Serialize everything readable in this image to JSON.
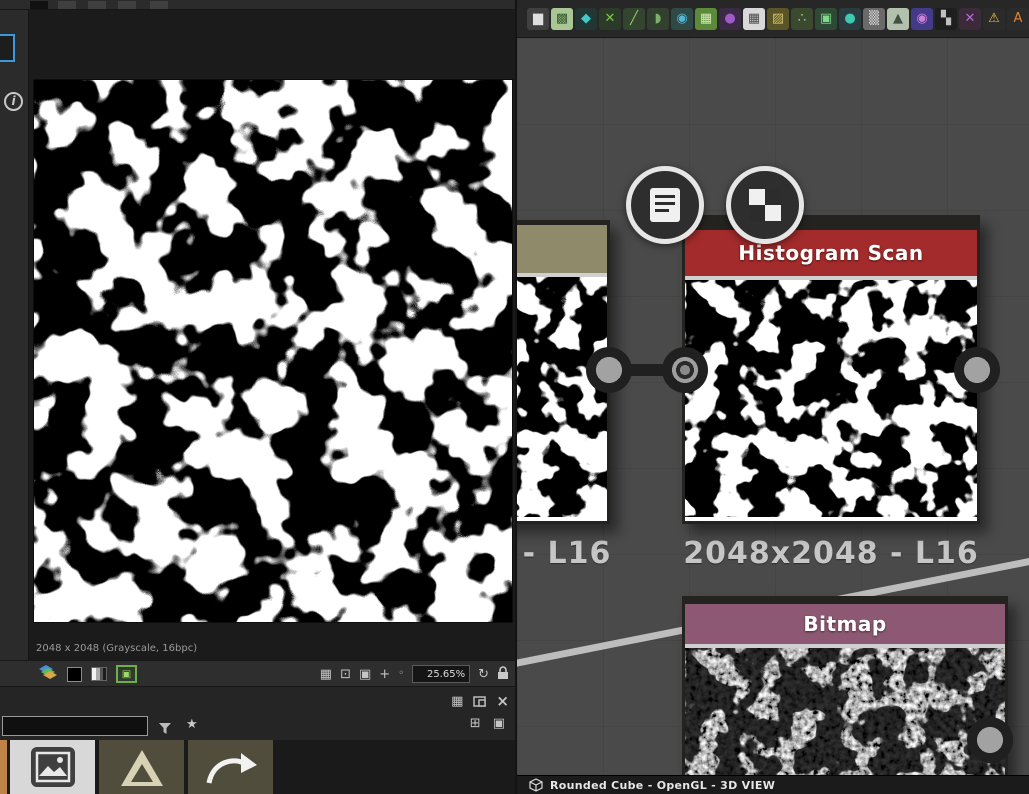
{
  "colors": {
    "graph_background": "#4a4a4a",
    "panel_background": "#2b2b2b",
    "accent_blue": "#3a9ad9",
    "histogram_header": "#a32b2b",
    "bitmap_header": "#8d5873",
    "partial_node_header": "#8f8a6a",
    "node_label_text": "#c6c6c6"
  },
  "view2d": {
    "status_text": "2048 x 2048 (Grayscale, 16bpc)",
    "zoom_value": "25.65%"
  },
  "library": {
    "filter_value": ""
  },
  "graph": {
    "partial_node": {
      "label": "- L16",
      "header_style": "background:#8f8a6a"
    },
    "histogram_node": {
      "title": "Histogram Scan",
      "label": "2048x2048 - L16",
      "header_style": "background:#a32b2b"
    },
    "bitmap_node": {
      "title": "Bitmap",
      "header_style": "background:#8d5873"
    }
  },
  "viewport_bar": {
    "text": "Rounded Cube - OpenGL - 3D VIEW"
  },
  "icon_glyphs": {
    "info": "i",
    "tiling": "▦",
    "fit": "⊡",
    "frame": "▣",
    "pan": "+",
    "dot": "◦",
    "refresh": "↻",
    "grid": "▦",
    "close": "×",
    "star": "★",
    "grid_plus": "⊞",
    "panel": "▣",
    "image_view": "▣"
  },
  "node_toolbar": {
    "icons": [
      {
        "name": "histogram-icon",
        "glyph": "▆",
        "style": "background:#404040;color:#e0e0e0"
      },
      {
        "name": "uniform-color-icon",
        "glyph": "▩",
        "style": "background:#a8c794;color:#355a2f"
      },
      {
        "name": "liquid-drop-icon",
        "glyph": "◆",
        "style": "background:#223733;color:#3fc9c9"
      },
      {
        "name": "cross-blend-icon",
        "glyph": "✕",
        "style": "background:#2c3a2a;color:#7ac943"
      },
      {
        "name": "slope-blur-icon",
        "glyph": "╱",
        "style": "background:#33452f;color:#9ccb69"
      },
      {
        "name": "droplet-icon",
        "glyph": "◗",
        "style": "background:#31402f;color:#7fb069"
      },
      {
        "name": "globe-icon",
        "glyph": "◉",
        "style": "background:#2f4a44;color:#52b7d9"
      },
      {
        "name": "green-grid-icon",
        "glyph": "▦",
        "style": "background:#5a8a3a;color:#d8e8b8"
      },
      {
        "name": "purple-orb-icon",
        "glyph": "●",
        "style": "background:#3a2a44;color:#a05ac9"
      },
      {
        "name": "transform-grid-icon",
        "glyph": "▦",
        "style": "background:#d8d8d8;color:#4a4a4a"
      },
      {
        "name": "olive-pattern-icon",
        "glyph": "▨",
        "style": "background:#5a5526;color:#cfc169"
      },
      {
        "name": "scatter-icon",
        "glyph": "∴",
        "style": "background:#3a4a2f;color:#9fd96a"
      },
      {
        "name": "tile-icon",
        "glyph": "▣",
        "style": "background:#2f4a34;color:#7fd98a"
      },
      {
        "name": "teal-sphere-icon",
        "glyph": "●",
        "style": "background:#2a3c40;color:#3fc9b0"
      },
      {
        "name": "noise-icon",
        "glyph": "▒",
        "style": "background:#6a6a6a;color:#d8d8d8"
      },
      {
        "name": "triangle-icon",
        "glyph": "▲",
        "style": "background:#b2c0ae;color:#41503f"
      },
      {
        "name": "color-sphere-icon",
        "glyph": "◉",
        "style": "background:#433a8a;color:#d07fd9"
      },
      {
        "name": "checker-small-icon",
        "glyph": "▚",
        "style": "background:#1e1e1e;color:#c0c0c0"
      },
      {
        "name": "purple-cross-icon",
        "glyph": "✕",
        "style": "background:#3a2a3a;color:#b96ad9"
      },
      {
        "name": "warning-icon",
        "glyph": "⚠",
        "style": "background:#2b2b2b;color:#e8c33a"
      },
      {
        "name": "text-node-icon",
        "glyph": "A",
        "style": "background:#2b2b2b;color:#e8832a"
      }
    ]
  }
}
